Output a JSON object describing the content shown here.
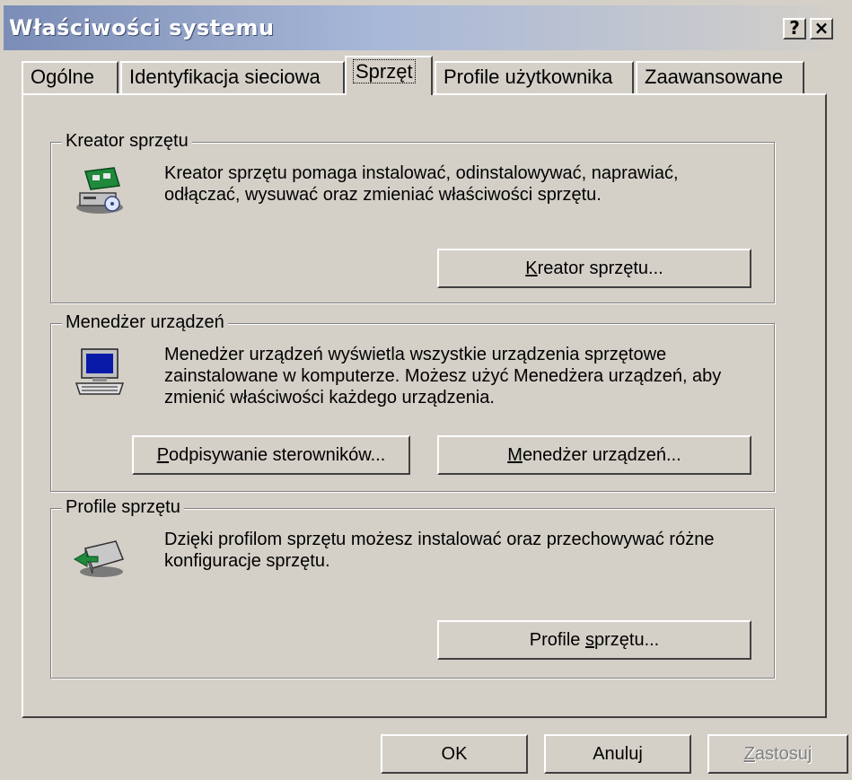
{
  "window": {
    "title": "Właściwości systemu",
    "help_btn": "?",
    "close_btn": "×"
  },
  "tabs": [
    {
      "label": "Ogólne"
    },
    {
      "label": "Identyfikacja sieciowa"
    },
    {
      "label": "Sprzęt"
    },
    {
      "label": "Profile użytkownika"
    },
    {
      "label": "Zaawansowane"
    }
  ],
  "groups": {
    "hardware_wizard": {
      "label": "Kreator sprzętu",
      "text": "Kreator sprzętu pomaga instalować, odinstalowywać, naprawiać, odłączać, wysuwać oraz zmieniać właściwości sprzętu.",
      "button": {
        "key": "K",
        "rest": "reator sprzętu..."
      },
      "icon": "hardware-wizard-icon"
    },
    "device_manager": {
      "label": "Menedżer urządzeń",
      "text": "Menedżer urządzeń wyświetla wszystkie urządzenia sprzętowe zainstalowane w komputerze. Możesz użyć Menedżera urządzeń, aby zmienić właściwości każdego urządzenia.",
      "button_sign": {
        "key": "P",
        "rest": "odpisywanie sterowników..."
      },
      "button_dm": {
        "key": "M",
        "rest": "enedżer urządzeń..."
      },
      "icon": "computer-icon"
    },
    "hardware_profiles": {
      "label": "Profile sprzętu",
      "text": "Dzięki profilom sprzętu możesz instalować oraz przechowywać różne konfiguracje sprzętu.",
      "button": {
        "pre": "Profile ",
        "key": "s",
        "rest": "przętu..."
      },
      "icon": "hardware-profile-icon"
    }
  },
  "footer": {
    "ok": "OK",
    "cancel": "Anuluj",
    "apply": {
      "key": "Z",
      "rest": "astosuj"
    }
  }
}
